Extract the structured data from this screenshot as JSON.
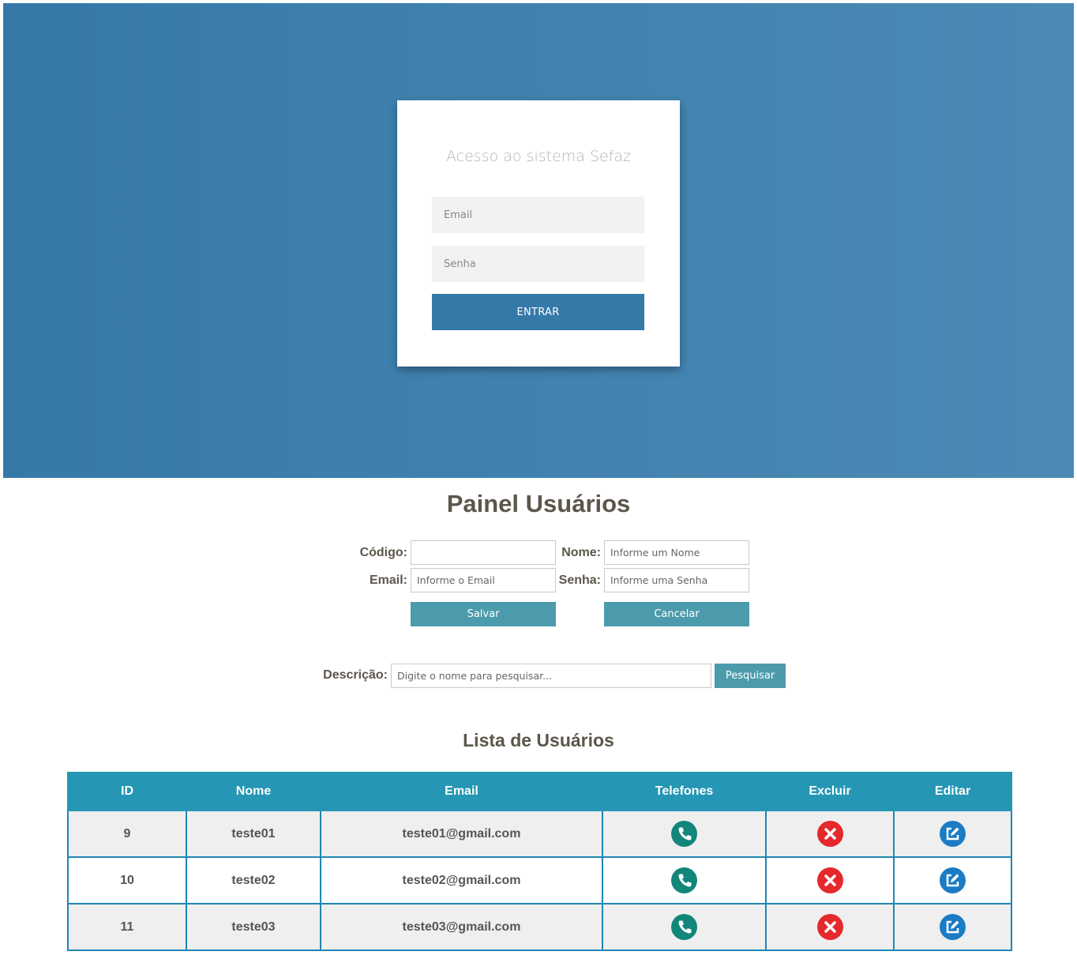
{
  "login": {
    "title": "Acesso ao sistema Sefaz",
    "email_placeholder": "Email",
    "password_placeholder": "Senha",
    "submit_label": "ENTRAR"
  },
  "panel": {
    "title": "Painel Usuários",
    "form": {
      "codigo_label": "Código:",
      "codigo_value": "",
      "nome_label": "Nome:",
      "nome_placeholder": "Informe um Nome",
      "email_label": "Email:",
      "email_placeholder": "Informe o Email",
      "senha_label": "Senha:",
      "senha_placeholder": "Informe uma Senha",
      "save_label": "Salvar",
      "cancel_label": "Cancelar"
    },
    "search": {
      "label": "Descrição:",
      "placeholder": "Digite o nome para pesquisar...",
      "button_label": "Pesquisar"
    }
  },
  "list": {
    "title": "Lista de Usuários",
    "columns": [
      "ID",
      "Nome",
      "Email",
      "Telefones",
      "Excluir",
      "Editar"
    ],
    "rows": [
      {
        "id": "9",
        "nome": "teste01",
        "email": "teste01@gmail.com"
      },
      {
        "id": "10",
        "nome": "teste02",
        "email": "teste02@gmail.com"
      },
      {
        "id": "11",
        "nome": "teste03",
        "email": "teste03@gmail.com"
      }
    ],
    "icons": {
      "phone": "phone-icon",
      "delete": "delete-icon",
      "edit": "edit-icon"
    }
  },
  "colors": {
    "hero_start": "#3579a8",
    "hero_end": "#4c8ab6",
    "login_button": "#3579a8",
    "teal_button": "#4c9bac",
    "table_header": "#2596b3",
    "table_border": "#1f86b4",
    "phone_icon": "#13867a",
    "delete_icon": "#e5282c",
    "edit_icon": "#1b7cc4"
  }
}
